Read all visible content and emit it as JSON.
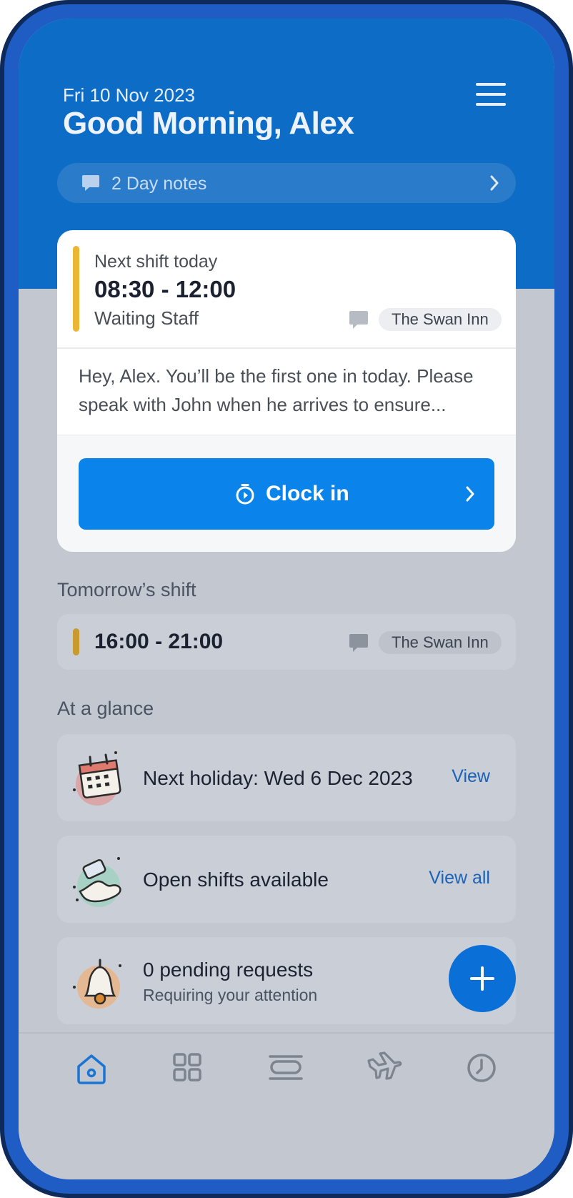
{
  "header": {
    "date": "Fri 10 Nov 2023",
    "greeting": "Good Morning, Alex",
    "menu_icon": "hamburger-menu-icon"
  },
  "day_notes": {
    "label": "2 Day notes"
  },
  "next_shift": {
    "label": "Next shift today",
    "time": "08:30 - 12:00",
    "role": "Waiting Staff",
    "venue": "The Swan Inn",
    "message": "Hey, Alex. You’ll be the first one in today. Please speak with John when he arrives to ensure...",
    "clock_in_label": "Clock in"
  },
  "tomorrow": {
    "title": "Tomorrow’s shift",
    "time": "16:00 - 21:00",
    "venue": "The Swan Inn"
  },
  "glance": {
    "title": "At a glance",
    "items": [
      {
        "title": "Next holiday: Wed 6 Dec 2023",
        "action": "View",
        "icon": "calendar-illustration"
      },
      {
        "title": "Open shifts available",
        "action": "View all",
        "icon": "hand-phone-illustration"
      },
      {
        "title": "0 pending requests",
        "subtitle": "Requiring your attention",
        "icon": "bell-illustration"
      }
    ]
  },
  "colors": {
    "brand_blue": "#0d6cc6",
    "button_blue": "#0a84eb",
    "shift_accent": "#eab634",
    "active_tab": "#1a74d4"
  },
  "tabs": [
    {
      "name": "home",
      "icon": "home-icon",
      "active": true
    },
    {
      "name": "grid",
      "icon": "grid-icon",
      "active": false
    },
    {
      "name": "shifts",
      "icon": "stack-icon",
      "active": false
    },
    {
      "name": "holiday",
      "icon": "plane-icon",
      "active": false
    },
    {
      "name": "time",
      "icon": "clock-icon",
      "active": false
    }
  ]
}
